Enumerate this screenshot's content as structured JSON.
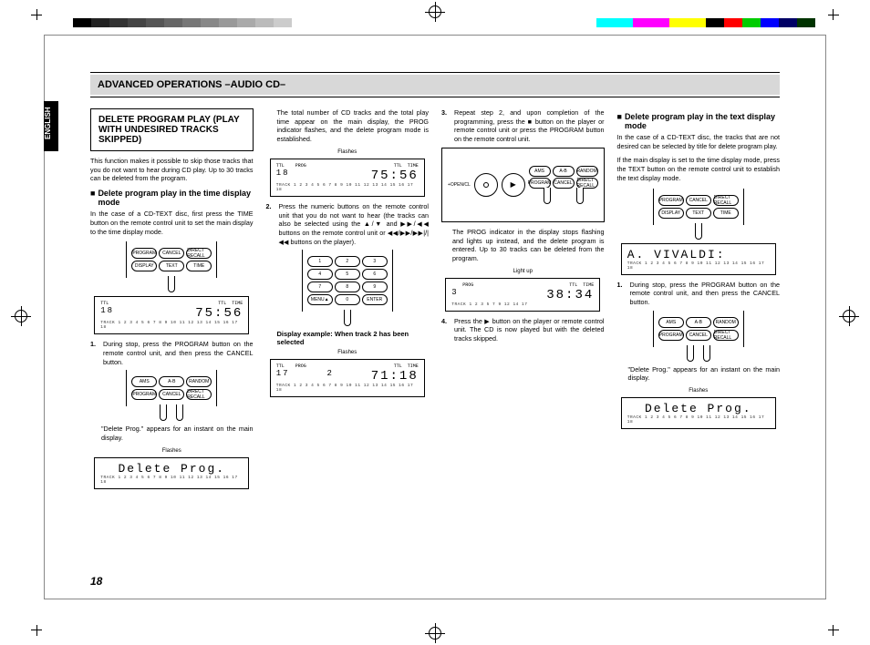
{
  "language_tab": "ENGLISH",
  "heading": "ADVANCED OPERATIONS  –AUDIO CD–",
  "page_number": "18",
  "col1": {
    "box_title": "DELETE PROGRAM PLAY (PLAY WITH UNDESIRED TRACKS SKIPPED)",
    "intro": "This function makes it possible to skip those tracks that you do not want to hear during CD play. Up to 30 tracks can be deleted from the program.",
    "subhead": "Delete program play in the time display mode",
    "subtext": "In the case of a CD-TEXT disc, first press the TIME button on the remote control unit to set the main display to the time display mode.",
    "remote_row1": [
      "PROGRAM",
      "CANCEL",
      "DIRECT RECALL"
    ],
    "remote_row2": [
      "DISPLAY",
      "TEXT",
      "TIME"
    ],
    "display1_left": "18",
    "display1_right": "75:56",
    "ticks": "TRACK  1 2  3 4  5 6  7 8  9 10  11 12  13 14  15 16  17 18",
    "step1": "During stop, press the PROGRAM button on the remote control unit, and then press the CANCEL button.",
    "remote2_row1": [
      "AMS",
      "A-B",
      "RANDOM"
    ],
    "remote2_row2": [
      "PROGRAM",
      "CANCEL",
      "DIRECT RECALL"
    ],
    "note1": "\"Delete Prog.\" appears for an instant on the main display.",
    "flashes": "Flashes",
    "delete_prog": "Delete Prog."
  },
  "col2": {
    "intro": "The total number of CD tracks and the total play time appear on the main display, the PROG indicator flashes, and the delete program mode is established.",
    "flashes": "Flashes",
    "disp_left": "18",
    "disp_right": "75:56",
    "step2": "Press the numeric buttons on the remote control unit that you do not want to hear (the tracks can also be selected using the ▲/▼ and ▶▶/◀◀ buttons on the remote control unit or ◀◀/▶▶/▶▶|/|◀◀ buttons on the player).",
    "numpad": [
      "1",
      "2",
      "3",
      "4",
      "5",
      "6",
      "7",
      "8",
      "9",
      "MENU▲",
      "0",
      "ENTER"
    ],
    "example_caption": "Display example: When track 2 has been selected",
    "disp2_left": "17",
    "disp2_mid": "2",
    "disp2_right": "71:18"
  },
  "col3": {
    "step3": "Repeat step 2, and upon completion of the programming, press the ■ button on the player or remote control unit or press the PROGRAM button on the remote control unit.",
    "player_labels": [
      "AMS",
      "A-B",
      "RANDOM",
      "PROGRAM",
      "CANCEL",
      "DIRECT RECALL"
    ],
    "para1": "The PROG indicator in the display stops flashing and lights up instead, and the delete program is entered.  Up to 30 tracks can be deleted from the program.",
    "light_up": "Light up",
    "disp_left": "3",
    "disp_right": "38:34",
    "ticks3": "TRACK  1 2  3  5  7  9  12  14  17",
    "step4": "Press the ▶ button on the player or remote control unit.  The CD is now played but with the deleted tracks skipped."
  },
  "col4": {
    "subhead": "Delete program play in the text display mode",
    "para1": "In the case of a CD-TEXT disc, the tracks that are not desired can be selected by title for delete program play.",
    "para2": "If the main display is set to the time display mode, press the TEXT button on the remote control unit to establish the text display mode.",
    "remote_row1": [
      "PROGRAM",
      "CANCEL",
      "DIRECT RECALL"
    ],
    "remote_row2": [
      "DISPLAY",
      "TEXT",
      "TIME"
    ],
    "vivaldi": "A. VIVALDI:",
    "step1": "During stop, press the PROGRAM button on the remote control unit, and then press the CANCEL button.",
    "remote2_row1": [
      "AMS",
      "A-B",
      "RANDOM"
    ],
    "remote2_row2": [
      "PROGRAM",
      "CANCEL",
      "DIRECT RECALL"
    ],
    "note1": "\"Delete Prog.\" appears for an instant on the main display.",
    "flashes": "Flashes",
    "delete_prog": "Delete Prog."
  }
}
